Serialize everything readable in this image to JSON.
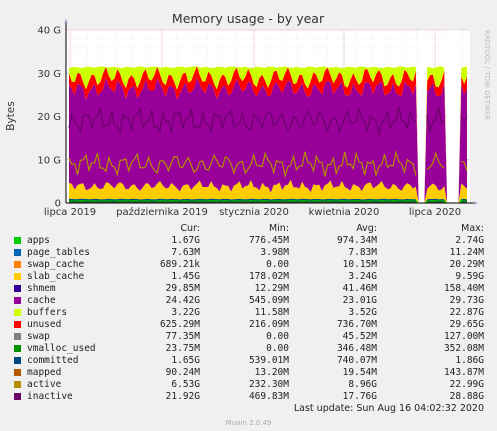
{
  "chart_data": {
    "type": "area",
    "title": "Memory usage - by year",
    "ylabel": "Bytes",
    "side_label": "RRDTOOL / TOBI OETIKER",
    "ylim": [
      0,
      40
    ],
    "y_unit": "G",
    "yticks": [
      "0",
      "10 G",
      "20 G",
      "30 G",
      "40 G"
    ],
    "xticks": [
      "lipca 2019",
      "października 2019",
      "stycznia 2020",
      "kwietnia 2020",
      "lipca 2020"
    ],
    "grid": true,
    "series": [
      {
        "name": "apps",
        "color": "#00cc00",
        "cur": "1.67G",
        "min": "776.45M",
        "avg": "974.34M",
        "max": "2.74G"
      },
      {
        "name": "page_tables",
        "color": "#0066b3",
        "cur": "7.63M",
        "min": "3.98M",
        "avg": "7.83M",
        "max": "11.24M"
      },
      {
        "name": "swap_cache",
        "color": "#ff8000",
        "cur": "689.21k",
        "min": "0.00",
        "avg": "10.15M",
        "max": "20.29M"
      },
      {
        "name": "slab_cache",
        "color": "#ffcc00",
        "cur": "1.45G",
        "min": "178.02M",
        "avg": "3.24G",
        "max": "9.59G"
      },
      {
        "name": "shmem",
        "color": "#330099",
        "cur": "29.85M",
        "min": "12.29M",
        "avg": "41.46M",
        "max": "158.40M"
      },
      {
        "name": "cache",
        "color": "#990099",
        "cur": "24.42G",
        "min": "545.09M",
        "avg": "23.01G",
        "max": "29.73G"
      },
      {
        "name": "buffers",
        "color": "#ccff00",
        "cur": "3.22G",
        "min": "11.58M",
        "avg": "3.52G",
        "max": "22.87G"
      },
      {
        "name": "unused",
        "color": "#ff0000",
        "cur": "625.29M",
        "min": "216.09M",
        "avg": "736.70M",
        "max": "29.65G"
      },
      {
        "name": "swap",
        "color": "#808080",
        "cur": "77.35M",
        "min": "0.00",
        "avg": "45.52M",
        "max": "127.00M"
      },
      {
        "name": "vmalloc_used",
        "color": "#008f00",
        "cur": "23.75M",
        "min": "0.00",
        "avg": "346.48M",
        "max": "352.08M"
      },
      {
        "name": "committed",
        "color": "#00487d",
        "cur": "1.65G",
        "min": "539.01M",
        "avg": "740.07M",
        "max": "1.86G"
      },
      {
        "name": "mapped",
        "color": "#b35a00",
        "cur": "90.24M",
        "min": "13.20M",
        "avg": "19.54M",
        "max": "143.87M"
      },
      {
        "name": "active",
        "color": "#b38f00",
        "cur": "6.53G",
        "min": "232.30M",
        "avg": "8.96G",
        "max": "22.99G"
      },
      {
        "name": "inactive",
        "color": "#6b006b",
        "cur": "21.92G",
        "min": "469.83M",
        "avg": "17.76G",
        "max": "28.88G"
      }
    ],
    "legend_headers": {
      "cur": "Cur:",
      "min": "Min:",
      "avg": "Avg:",
      "max": "Max:"
    }
  },
  "footer": {
    "last_update": "Last update: Sun Aug 16 04:02:32 2020",
    "version": "Munin 2.0.49"
  }
}
